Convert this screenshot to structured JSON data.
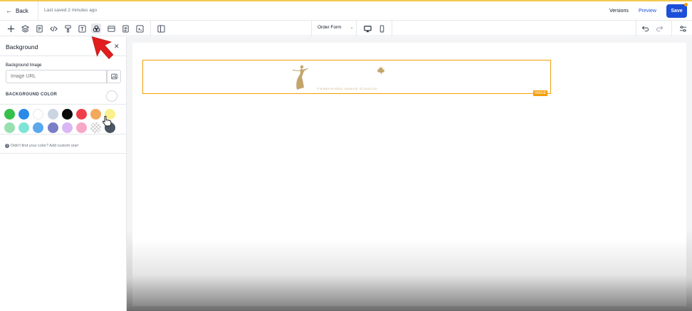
{
  "header": {
    "back_label": "Back",
    "last_saved": "Last saved 2 minutes ago",
    "versions_label": "Versions",
    "preview_label": "Preview",
    "save_label": "Save"
  },
  "toolbar": {
    "icons": [
      "plus-icon",
      "layers-icon",
      "pages-icon",
      "code-icon",
      "paint-roller-icon",
      "text-icon",
      "colors-icon",
      "section-icon",
      "form-icon",
      "custom-code-icon",
      "columns-icon"
    ],
    "active_icon": "colors-icon",
    "form_select": "Order Form",
    "devices": [
      "desktop-icon",
      "mobile-icon"
    ],
    "right_icons": [
      "undo-icon",
      "redo-icon",
      "settings-icon"
    ]
  },
  "panel": {
    "title": "Background",
    "background_image_label": "Background Image",
    "image_url_placeholder": "Image URL",
    "background_color_label": "BACKGROUND COLOR",
    "swatches": [
      [
        "#34c04a",
        "#2b8ae8",
        "#ffffff",
        "#cbd5e1",
        "#0a0a0a",
        "#ef3e4a",
        "#f3a95a",
        "#faf08c"
      ],
      [
        "#98e0b0",
        "#7fe3d8",
        "#5aa8ee",
        "#7a7ec7",
        "#d9b6f5",
        "#f7a8c6",
        "transparent",
        "#4b5563"
      ]
    ],
    "hint": "Didn't find your color? Add custom one!"
  },
  "canvas": {
    "image_badge": "IMAGE",
    "brand_text": "FRANCHISED DANCE STUDIOS·"
  },
  "colors": {
    "accent": "#1d4ed8",
    "selection": "#f59e0b",
    "arrow": "#e11d1d"
  }
}
